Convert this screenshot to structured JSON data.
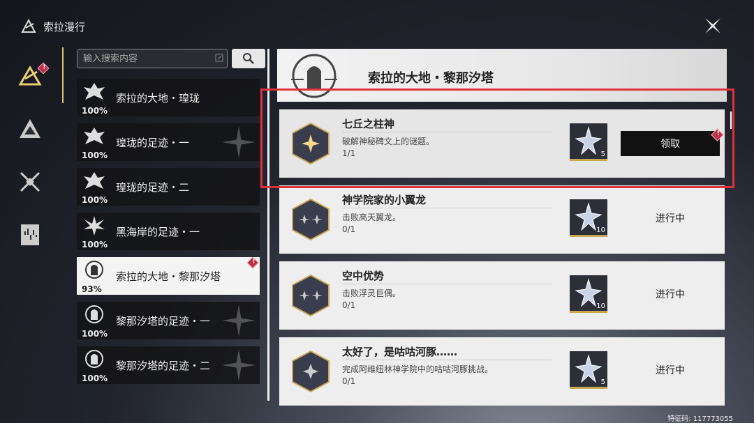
{
  "app": {
    "title": "索拉漫行"
  },
  "search": {
    "placeholder": "输入搜索内容"
  },
  "list": [
    {
      "label": "索拉的大地・瑝珑",
      "percent": "100%",
      "active": false,
      "badge": false
    },
    {
      "label": "瑝珑的足迹・一",
      "percent": "100%",
      "active": false,
      "badge": false
    },
    {
      "label": "瑝珑的足迹・二",
      "percent": "100%",
      "active": false,
      "badge": false
    },
    {
      "label": "黑海岸的足迹・一",
      "percent": "100%",
      "active": false,
      "badge": false
    },
    {
      "label": "索拉的大地・黎那汐塔",
      "percent": "93%",
      "active": true,
      "badge": true
    },
    {
      "label": "黎那汐塔的足迹・一",
      "percent": "100%",
      "active": false,
      "badge": false
    },
    {
      "label": "黎那汐塔的足迹・二",
      "percent": "100%",
      "active": false,
      "badge": false
    }
  ],
  "detail": {
    "title": "索拉的大地・黎那汐塔",
    "tasks": [
      {
        "title": "七丘之柱神",
        "desc": "破解神秘碑文上的谜题。",
        "progress": "1/1",
        "reward_qty": "5",
        "action": "领取",
        "claimable": true
      },
      {
        "title": "神学院家的小翼龙",
        "desc": "击败高天翼龙。",
        "progress": "0/1",
        "reward_qty": "10",
        "action": "进行中",
        "claimable": false
      },
      {
        "title": "空中优势",
        "desc": "击败浮灵巨偶。",
        "progress": "0/1",
        "reward_qty": "10",
        "action": "进行中",
        "claimable": false
      },
      {
        "title": "太好了，是咕咕河豚……",
        "desc": "完成阿维纽林神学院中的咕咕河豚挑战。",
        "progress": "0/1",
        "reward_qty": "5",
        "action": "进行中",
        "claimable": false
      }
    ]
  },
  "footer": {
    "code": "特征码: 117773055"
  },
  "colors": {
    "accent_gold": "#d8c27a",
    "badge_red": "#c0304a",
    "highlight_red": "#e0303a"
  }
}
